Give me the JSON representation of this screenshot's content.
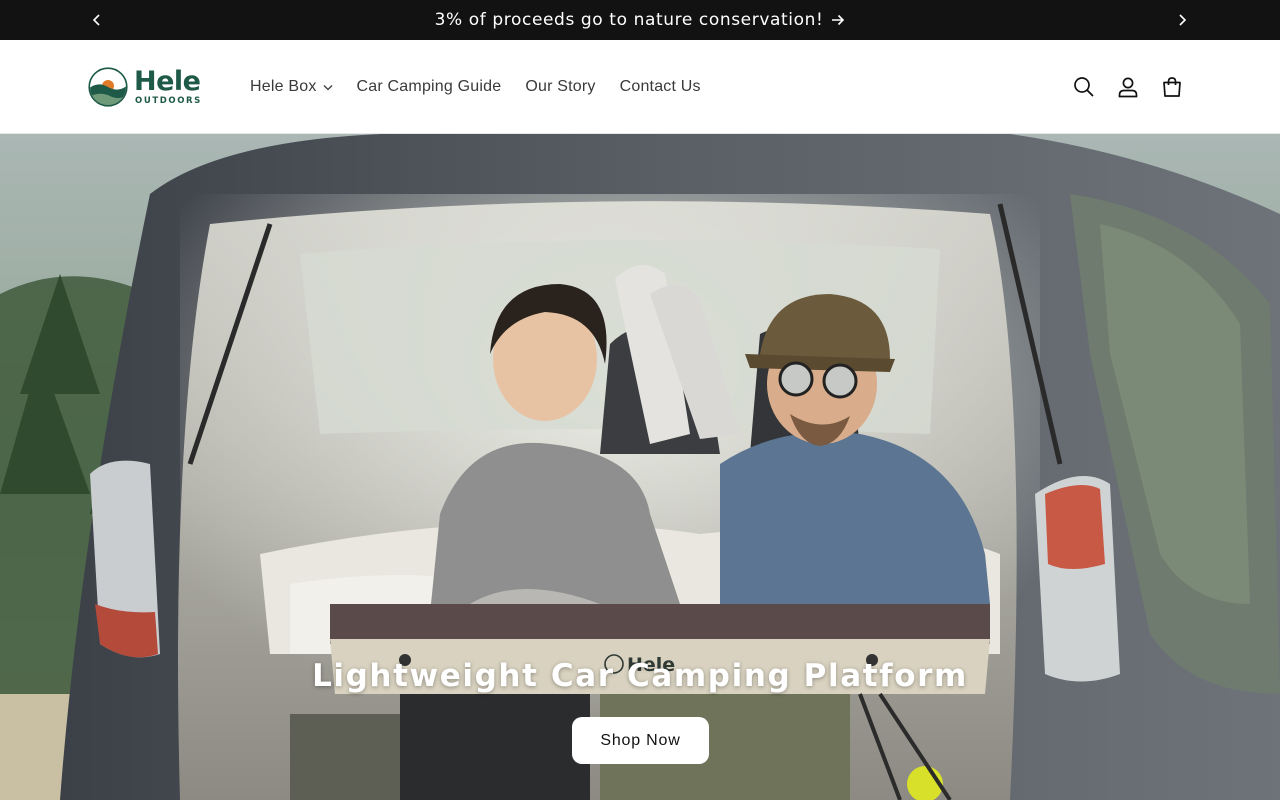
{
  "announcement": {
    "message": "3% of proceeds go to nature conservation!",
    "prev_icon": "chevron-left-icon",
    "next_icon": "chevron-right-icon",
    "arrow_icon": "arrow-right-icon"
  },
  "header": {
    "logo": {
      "word": "Hele",
      "sub": "OUTDOORS"
    },
    "nav": [
      {
        "label": "Hele Box",
        "has_dropdown": true
      },
      {
        "label": "Car Camping Guide"
      },
      {
        "label": "Our Story"
      },
      {
        "label": "Contact Us"
      }
    ],
    "icons": [
      "search-icon",
      "account-icon",
      "cart-icon"
    ]
  },
  "hero": {
    "title": "Lightweight Car Camping Platform",
    "button_label": "Shop Now",
    "platform_logo": "Hele"
  },
  "colors": {
    "brand_green": "#1e5a47",
    "brand_orange": "#e07b2a",
    "announcement_bg": "#121212"
  }
}
